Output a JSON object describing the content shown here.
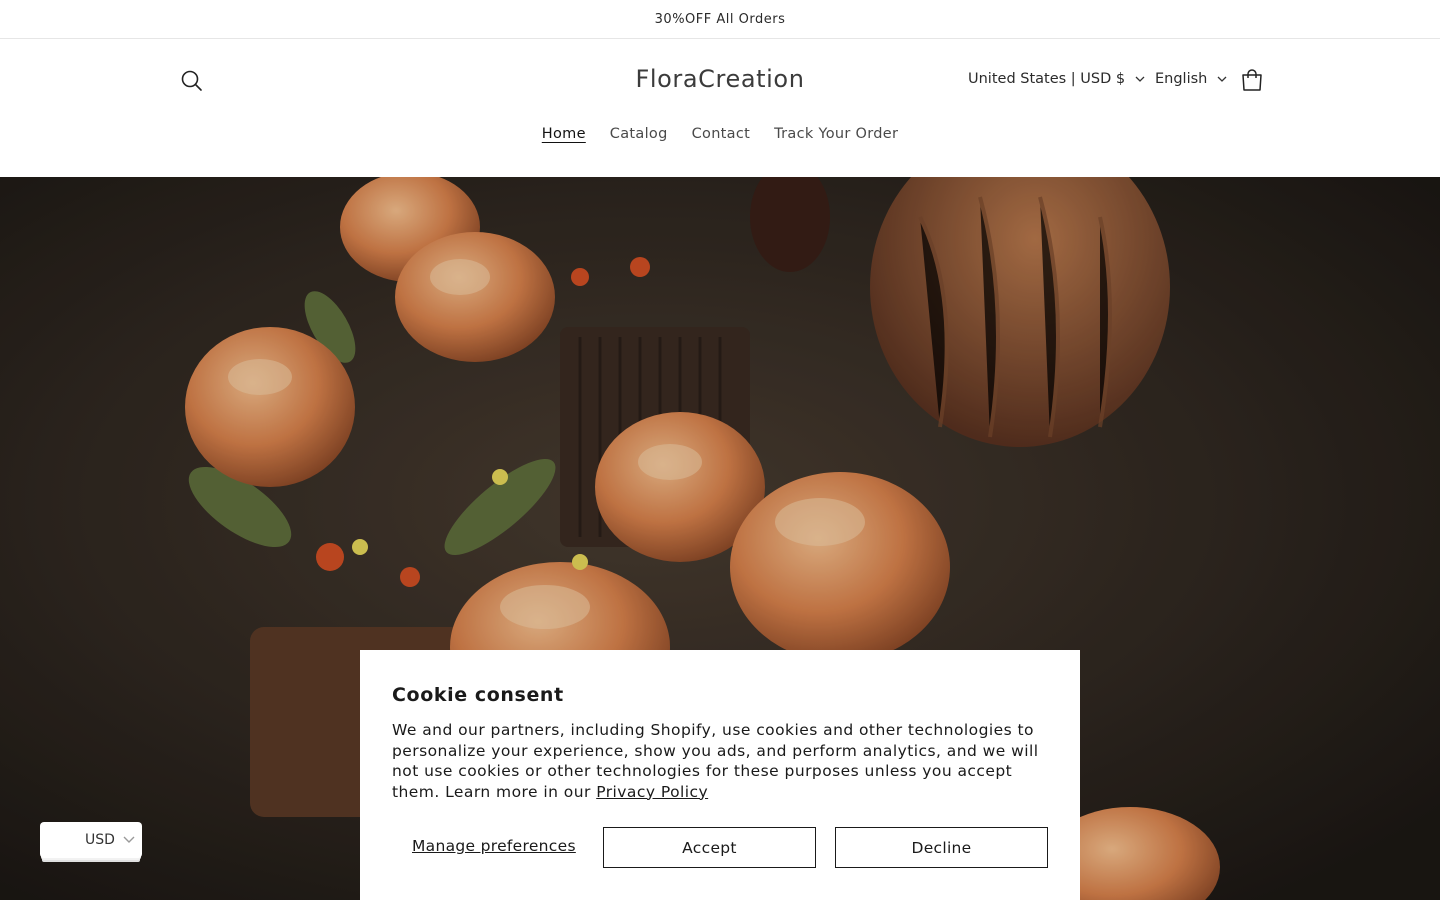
{
  "announcement": {
    "text": "30%OFF All Orders"
  },
  "header": {
    "logo": "FloraCreation",
    "country_selector": "United States | USD $",
    "language_selector": "English",
    "icons": {
      "search": "search-icon",
      "cart": "cart-icon"
    }
  },
  "nav": {
    "items": [
      {
        "label": "Home",
        "active": true
      },
      {
        "label": "Catalog",
        "active": false
      },
      {
        "label": "Contact",
        "active": false
      },
      {
        "label": "Track Your Order",
        "active": false
      }
    ]
  },
  "cookie_banner": {
    "title": "Cookie consent",
    "body": "We and our partners, including Shopify, use cookies and other technologies to personalize your experience, show you ads, and perform analytics, and we will not use cookies or other technologies for these purposes unless you accept them. Learn more in our",
    "privacy_link": "Privacy Policy",
    "manage_label": "Manage preferences",
    "accept_label": "Accept",
    "decline_label": "Decline"
  },
  "currency_widget": {
    "label": "USD"
  },
  "colors": {
    "accent": "#121212",
    "hero_bg": "#2d2620",
    "flower": "#e8935a"
  }
}
